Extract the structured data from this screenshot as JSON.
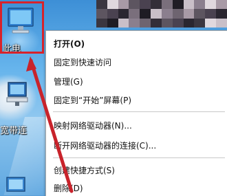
{
  "desktop": {
    "icons": [
      {
        "label": "此电",
        "icon": "computer-icon"
      },
      {
        "label": "宽带连",
        "icon": "broadband-icon"
      },
      {
        "label": "",
        "icon": "network-icon"
      }
    ]
  },
  "context_menu": {
    "items": [
      {
        "label": "打开(O)",
        "bold": true
      },
      {
        "label": "固定到快速访问"
      },
      {
        "label": "管理(G)"
      },
      {
        "label": "固定到“开始”屏幕(P)"
      },
      {
        "label": "映射网络驱动器(N)..."
      },
      {
        "label": "断开网络驱动器的连接(C)..."
      },
      {
        "label": "创建快捷方式(S)"
      },
      {
        "label": "删除(D)"
      }
    ]
  },
  "colors": {
    "highlight_box": "#d8222a",
    "arrow": "#c8232b",
    "menu_bg": "#ffffff",
    "desktop_blue": "#5b9fd8"
  }
}
